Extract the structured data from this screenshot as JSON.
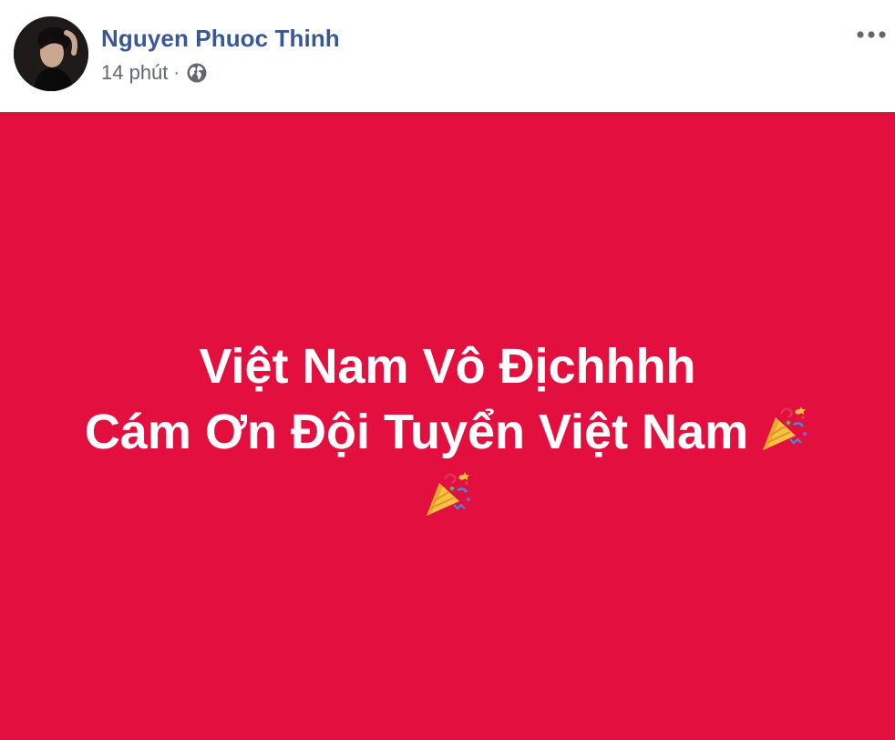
{
  "post": {
    "author": {
      "name": "Nguyen Phuoc Thinh",
      "avatar_icon": "profile-photo"
    },
    "meta": {
      "time": "14 phút",
      "separator": "·",
      "privacy_icon": "globe-icon"
    },
    "more_icon": "more-options-icon",
    "background_color": "#e20f3f",
    "status": {
      "line1": "Việt Nam Vô Địchhhh",
      "line2": "Cám Ơn Đội Tuyển Việt Nam",
      "emoji": "party-popper-icon",
      "text_color": "#ffffff"
    }
  }
}
